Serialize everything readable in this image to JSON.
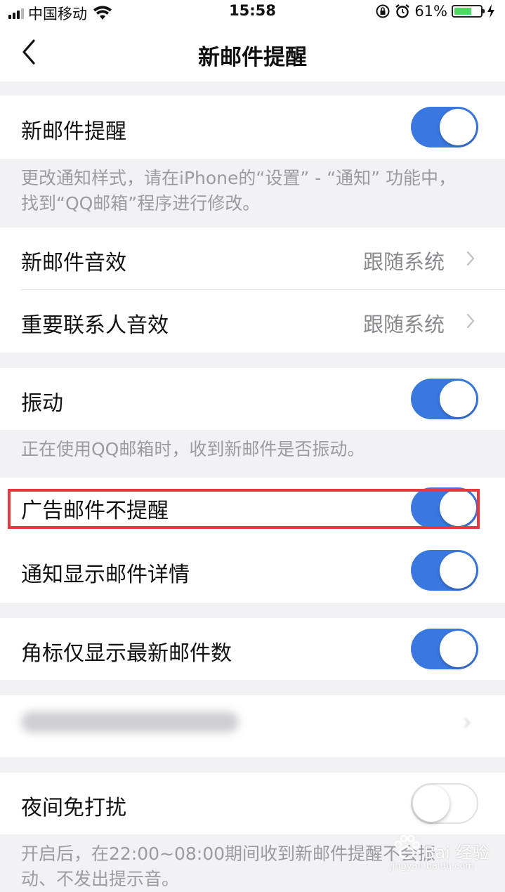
{
  "status_bar": {
    "carrier": "中国移动",
    "time": "15:58",
    "battery_percent": "61%",
    "battery_level": 0.61,
    "icons": [
      "signal-icon",
      "wifi-icon",
      "orientation-lock-icon",
      "alarm-icon",
      "battery-icon",
      "charging-icon"
    ]
  },
  "nav": {
    "title": "新邮件提醒",
    "back_icon": "chevron-left-icon"
  },
  "groups": {
    "new_mail": {
      "label": "新邮件提醒",
      "toggle_on": true,
      "footnote": "更改通知样式，请在iPhone的“设置” - “通知” 功能中，找到“QQ邮箱”程序进行修改。"
    },
    "sounds": {
      "new_mail_sound": {
        "label": "新邮件音效",
        "value": "跟随系统"
      },
      "vip_sound": {
        "label": "重要联系人音效",
        "value": "跟随系统"
      }
    },
    "vibration": {
      "label": "振动",
      "toggle_on": true,
      "footnote": "正在使用QQ邮箱时，收到新邮件是否振动。"
    },
    "ads_and_details": {
      "ads": {
        "label": "广告邮件不提醒",
        "toggle_on": true,
        "highlighted": true
      },
      "details": {
        "label": "通知显示邮件详情",
        "toggle_on": true
      }
    },
    "badge": {
      "label": "角标仅显示最新邮件数",
      "toggle_on": true
    },
    "blurred_row": {
      "note": ""
    },
    "night": {
      "label": "夜间免打扰",
      "toggle_on": false,
      "footnote": "开启后，在22:00~08:00期间收到新邮件提醒不会振动、不发出提示音。"
    }
  },
  "colors": {
    "toggle_on": "#3a78e0",
    "highlight_border": "#e8383d",
    "background": "#f2f2f4"
  },
  "watermark": {
    "text": "Bai 经验",
    "sub": "jingyan.baidu.com"
  }
}
